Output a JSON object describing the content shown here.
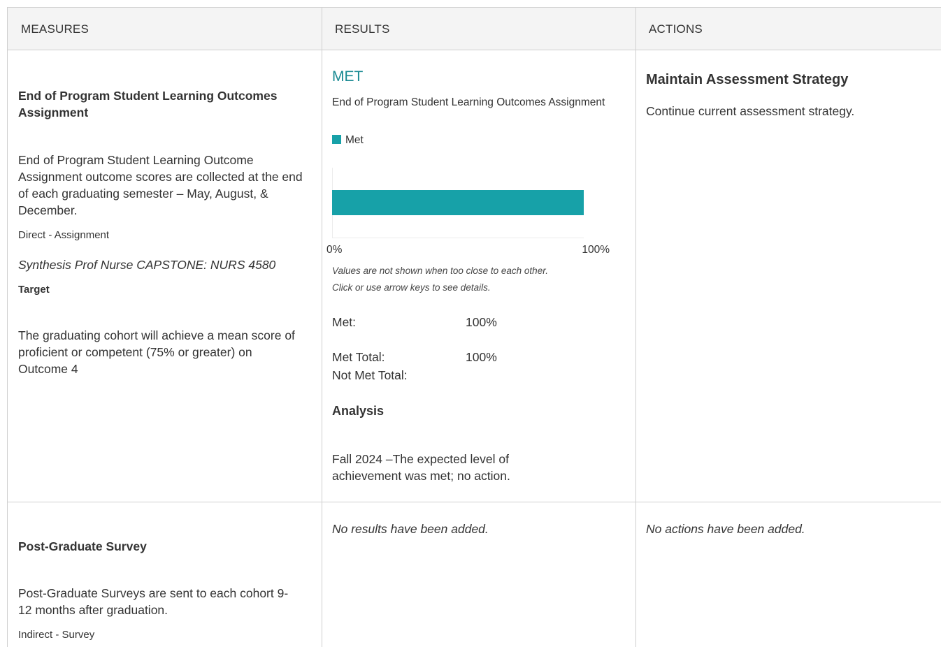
{
  "headers": {
    "measures": "MEASURES",
    "results": "RESULTS",
    "actions": "ACTIONS"
  },
  "row1": {
    "measure": {
      "title": "End of Program Student Learning Outcomes Assignment",
      "description": "End of Program Student Learning Outcome Assignment outcome scores are collected at the end of each graduating semester – May, August, & December.",
      "type": "Direct - Assignment",
      "course": "Synthesis Prof Nurse CAPSTONE: NURS 4580",
      "target_label": "Target",
      "target_text": "The graduating cohort will achieve a mean score of proficient or competent (75% or greater) on Outcome 4"
    },
    "result": {
      "status": "MET",
      "chart_title": "End of Program Student Learning Outcomes Assignment",
      "note_line1": "Values are not shown when too close to each other.",
      "note_line2": "Click or use arrow keys to see details.",
      "met_label": "Met:",
      "met_value": "100%",
      "met_total_label": "Met Total:",
      "met_total_value": "100%",
      "not_met_total_label": "Not Met Total:",
      "analysis_label": "Analysis",
      "analysis_text": "Fall 2024 –The expected level of achievement was met; no action."
    },
    "action": {
      "title": "Maintain Assessment Strategy",
      "text": "Continue current assessment strategy."
    }
  },
  "row2": {
    "measure": {
      "title": "Post-Graduate Survey",
      "description": "Post-Graduate Surveys are sent to each cohort 9-12 months after graduation.",
      "type": "Indirect - Survey"
    },
    "result_empty": "No results have been added.",
    "action_empty": "No actions have been added."
  },
  "colors": {
    "accent": "#17a1a8",
    "status": "#1a8a93",
    "border": "#cfcfcf",
    "header_bg": "#f4f4f4"
  },
  "chart_data": {
    "type": "bar",
    "orientation": "horizontal",
    "title": "End of Program Student Learning Outcomes Assignment",
    "categories": [
      "Met"
    ],
    "series": [
      {
        "name": "Met",
        "values": [
          100
        ]
      }
    ],
    "xlim": [
      0,
      100
    ],
    "x_tick_labels": [
      "0%",
      "100%"
    ],
    "legend": "top-left",
    "grid": false
  }
}
